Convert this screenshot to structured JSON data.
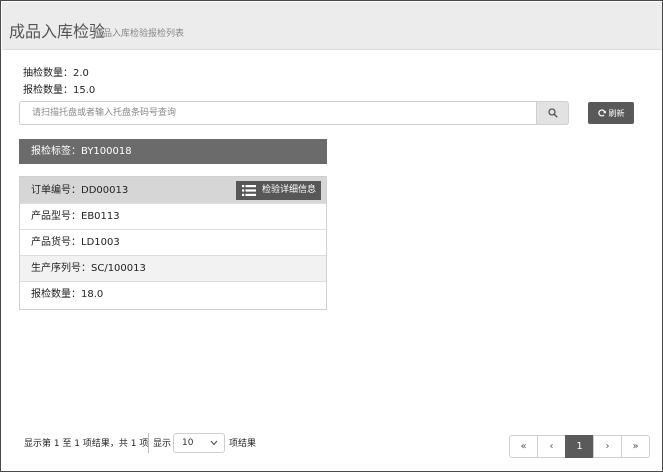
{
  "header": {
    "title": "成品入库检验",
    "subtitle": "成品入库检验报检列表"
  },
  "stats": {
    "sample_qty": "抽检数量：2.0",
    "report_qty": "报检数量：15.0"
  },
  "search": {
    "placeholder": "请扫描托盘或者输入托盘条码号查询",
    "button_icon": "search-icon"
  },
  "toolbar": {
    "refresh_label": "刷新",
    "refresh_icon": "refresh-icon"
  },
  "inspection_label": "报检标签：BY100018",
  "card": {
    "rows": [
      {
        "text": "订单编号：DD00013"
      },
      {
        "text": "产品型号：EB0113"
      },
      {
        "text": "产品货号：LD1003"
      },
      {
        "text": "生产序列号：SC/100013"
      },
      {
        "text": "报检数量：18.0"
      }
    ],
    "detail_button_label": "检验详细信息",
    "detail_button_icon": "list-icon"
  },
  "footer": {
    "info": "显示第 1 至 1 项结果，共 1 项",
    "show_prefix": "显示",
    "page_size": "10",
    "show_suffix": "项结果"
  },
  "pagination": {
    "first": "«",
    "prev": "‹",
    "current": "1",
    "next": "›",
    "last": "»"
  },
  "colors": {
    "dark_gray": "#595959",
    "label_bar": "#6b6b6b",
    "header_bg": "#ececec"
  }
}
